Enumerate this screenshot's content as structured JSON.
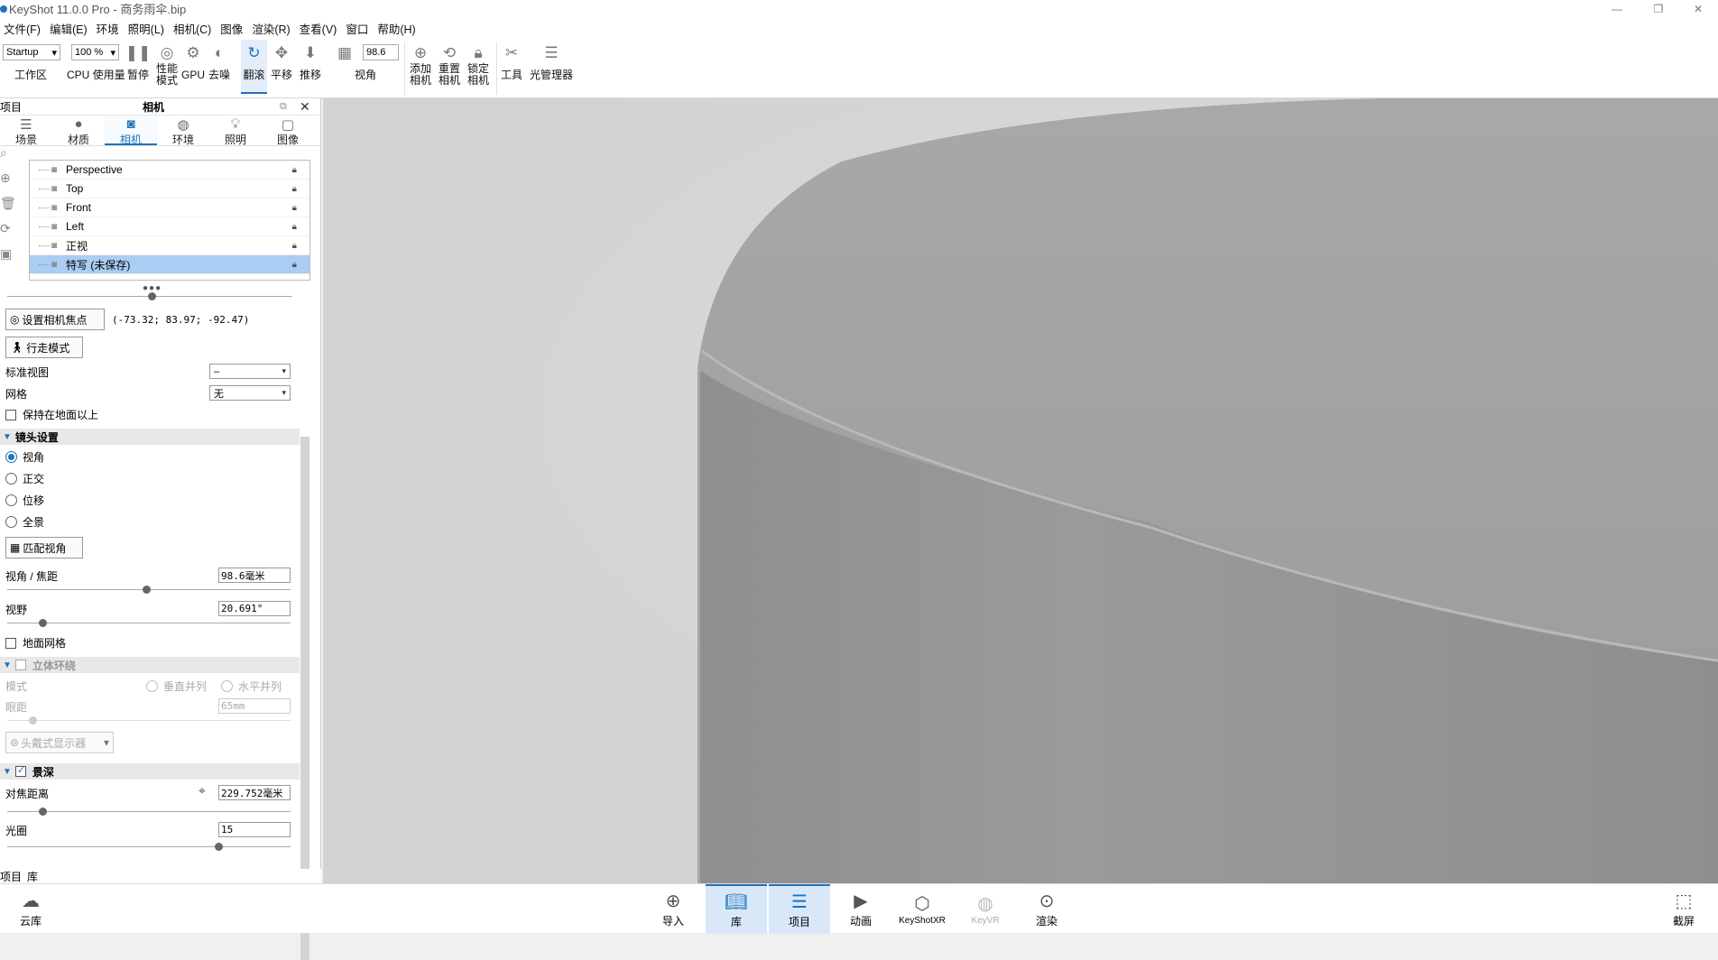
{
  "window": {
    "title": "KeyShot 11.0.0 Pro  - 商务雨伞.bip"
  },
  "menu": [
    "文件(F)",
    "编辑(E)",
    "环境",
    "照明(L)",
    "相机(C)",
    "图像",
    "渲染(R)",
    "查看(V)",
    "窗口",
    "帮助(H)"
  ],
  "toolbar": {
    "workspace_value": "Startup",
    "workspace_label": "工作区",
    "cpu_value": "100 %",
    "cpu_label": "CPU 使用量",
    "pause": "暂停",
    "perf1": "性能",
    "perf2": "模式",
    "gpu": "GPU",
    "denoise": "去噪",
    "tumble": "翻滚",
    "pan": "平移",
    "dolly": "推移",
    "fov_value": "98.6",
    "fov_label": "视角",
    "add_cam1": "添加",
    "add_cam2": "相机",
    "reset_cam1": "重置",
    "reset_cam2": "相机",
    "lock_cam1": "锁定",
    "lock_cam2": "相机",
    "tools": "工具",
    "light_manager": "光管理器"
  },
  "panel": {
    "left_label": "项目",
    "title": "相机",
    "tabs": [
      "场景",
      "材质",
      "相机",
      "环境",
      "照明",
      "图像"
    ],
    "cameras": [
      "Perspective",
      "Top",
      "Front",
      "Left",
      "正视",
      "特写 (未保存)"
    ],
    "set_focus_btn": "设置相机焦点",
    "focus_coords": "(-73.32; 83.97; -92.47)",
    "walk_mode_btn": "行走模式",
    "std_view_label": "标准视图",
    "std_view_value": "–",
    "grid_label": "网格",
    "grid_value": "无",
    "keep_above_ground": "保持在地面以上",
    "lens_section": "镜头设置",
    "lens_options": [
      "视角",
      "正交",
      "位移",
      "全景"
    ],
    "match_view_btn": "匹配视角",
    "fov_focal_label": "视角 / 焦距",
    "fov_focal_value": "98.6毫米",
    "fov_label": "视野",
    "fov_value": "20.691°",
    "ground_grid": "地面网格",
    "stereo_section": "立体环绕",
    "stereo_mode_label": "模式",
    "stereo_vertical": "垂直并列",
    "stereo_horizontal": "水平并列",
    "eye_dist_label": "眼距",
    "eye_dist_value": "65mm",
    "hmd_label": "头戴式显示器",
    "dof_section": "景深",
    "focus_dist_label": "对焦距离",
    "focus_dist_value": "229.752毫米",
    "aperture_label": "光圈",
    "aperture_value": "15"
  },
  "bottom_tabs": [
    "项目",
    "库"
  ],
  "bottombar": {
    "cloud": "云库",
    "import": "导入",
    "library": "库",
    "project": "项目",
    "animation": "动画",
    "keyshotxr": "KeyShotXR",
    "keyvr": "KeyVR",
    "render": "渲染",
    "screenshot": "截屏"
  }
}
